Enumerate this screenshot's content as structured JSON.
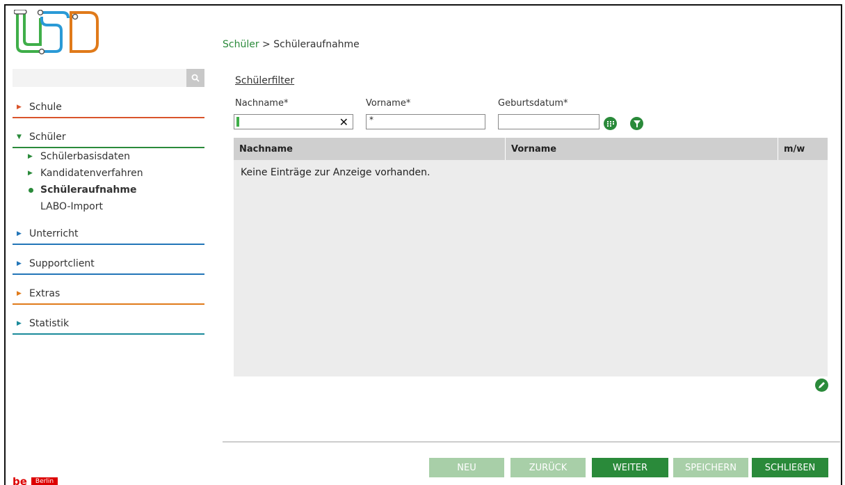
{
  "breadcrumb": {
    "parent": "Schüler",
    "separator": " > ",
    "current": "Schüleraufnahme"
  },
  "search": {
    "placeholder": "",
    "icon": "search-icon"
  },
  "nav": {
    "items": [
      {
        "label": "Schule",
        "color": "#d9542b"
      },
      {
        "label": "Schüler",
        "color": "#2a8a3a",
        "expanded": true,
        "children": [
          {
            "label": "Schülerbasisdaten"
          },
          {
            "label": "Kandidatenverfahren"
          },
          {
            "label": "Schüleraufnahme",
            "active": true
          },
          {
            "label": "LABO-Import"
          }
        ]
      },
      {
        "label": "Unterricht",
        "color": "#2275b8"
      },
      {
        "label": "Supportclient",
        "color": "#2275b8"
      },
      {
        "label": "Extras",
        "color": "#e07a1a"
      },
      {
        "label": "Statistik",
        "color": "#1a8a9a"
      }
    ]
  },
  "filter": {
    "title": "Schülerfilter",
    "nachname_label": "Nachname*",
    "vorname_label": "Vorname*",
    "geburtsdatum_label": "Geburtsdatum*",
    "nachname_value": "",
    "vorname_value": "*",
    "geburtsdatum_value": ""
  },
  "table": {
    "columns": [
      "Nachname",
      "Vorname",
      "m/w"
    ],
    "empty_text": "Keine Einträge zur Anzeige vorhanden."
  },
  "footer": {
    "neu": "NEU",
    "zurueck": "ZURÜCK",
    "weiter": "WEITER",
    "speichern": "SPEICHERN",
    "schliessen": "SCHLIEßEN"
  },
  "brand": {
    "be": "be",
    "berlin": "Berlin"
  },
  "colors": {
    "accent": "#2a8a3a",
    "disabled": "#a8cfa8"
  }
}
